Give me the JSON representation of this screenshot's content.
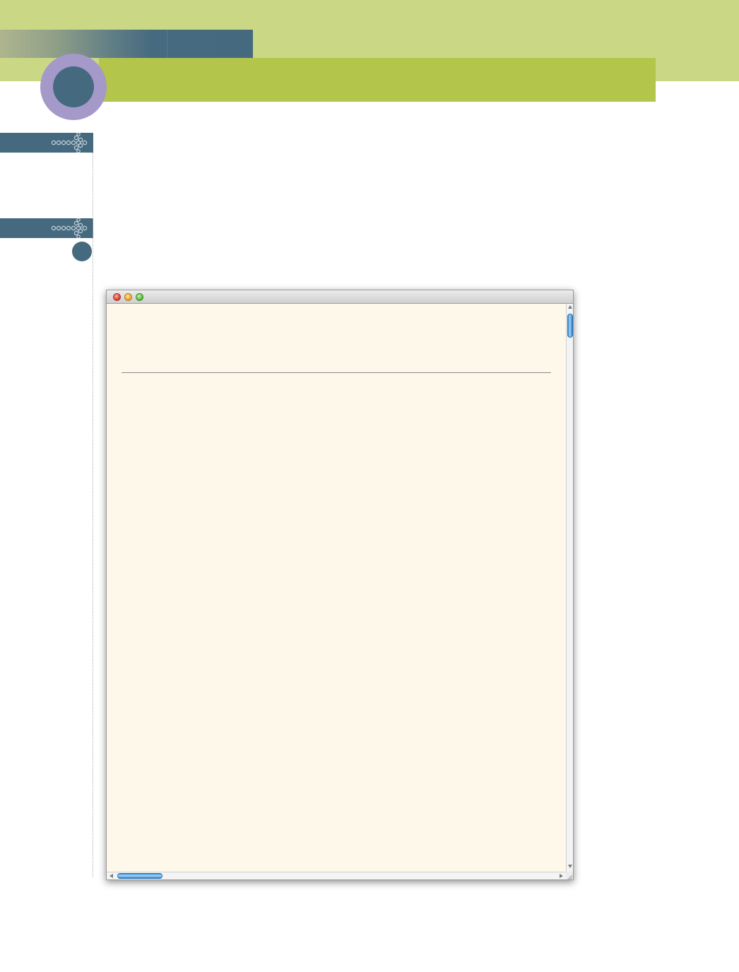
{
  "theme": {
    "band_color": "#cad885",
    "title_bar_color": "#b3c54b",
    "accent_blue": "#456a80",
    "circle_color": "#a499c9",
    "window_content_bg": "#fdf8ea"
  },
  "icons": {
    "side_tag": "dotted-arrow-icon",
    "window_close": "close-traffic-light-icon",
    "window_minimize": "minimize-traffic-light-icon",
    "window_zoom": "zoom-traffic-light-icon",
    "scroll_up": "triangle-up-icon",
    "scroll_down": "triangle-down-icon",
    "scroll_left": "triangle-left-icon",
    "scroll_right": "triangle-right-icon",
    "resize": "resize-grip-icon"
  },
  "browser_window": {
    "title": "",
    "content_text": "",
    "scroll_position": {
      "vertical": 0,
      "horizontal": 0
    }
  }
}
